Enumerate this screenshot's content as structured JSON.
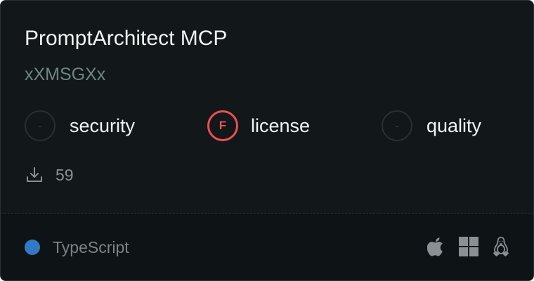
{
  "card": {
    "title": "PromptArchitect MCP",
    "author": "xXMSGXx",
    "grades": [
      {
        "grade": "-",
        "label": "security",
        "status": "none"
      },
      {
        "grade": "F",
        "label": "license",
        "status": "fail"
      },
      {
        "grade": "-",
        "label": "quality",
        "status": "none"
      }
    ],
    "downloads": {
      "icon": "download-icon",
      "count": "59"
    },
    "language": {
      "name": "TypeScript",
      "color": "#3178c6"
    },
    "platforms": [
      "apple-icon",
      "windows-icon",
      "linux-icon"
    ]
  },
  "colors": {
    "background": "#121719",
    "footer_background": "#0e1315",
    "fail": "#ea4f55",
    "author": "#6f8580"
  }
}
